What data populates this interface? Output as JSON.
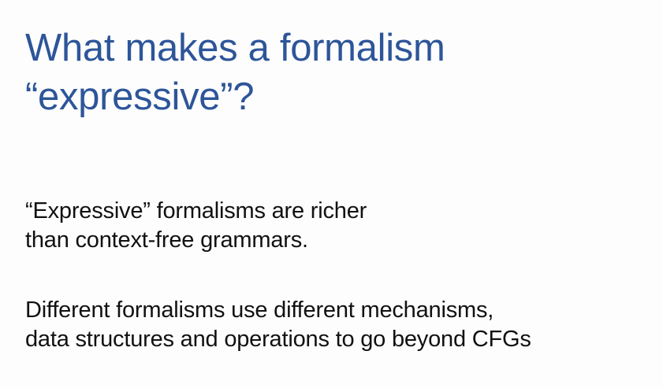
{
  "slide": {
    "title_lines": [
      "What makes a formalism",
      "“expressive”?"
    ],
    "paragraphs": [
      {
        "lines": [
          "“Expressive” formalisms are richer",
          "than context-free grammars."
        ]
      },
      {
        "lines": [
          "Different formalisms use different mechanisms,",
          "data structures and operations to go beyond CFGs"
        ]
      }
    ],
    "colors": {
      "title": "#2d5599",
      "body_text": "#111111",
      "background": "#fdfdfd"
    }
  }
}
